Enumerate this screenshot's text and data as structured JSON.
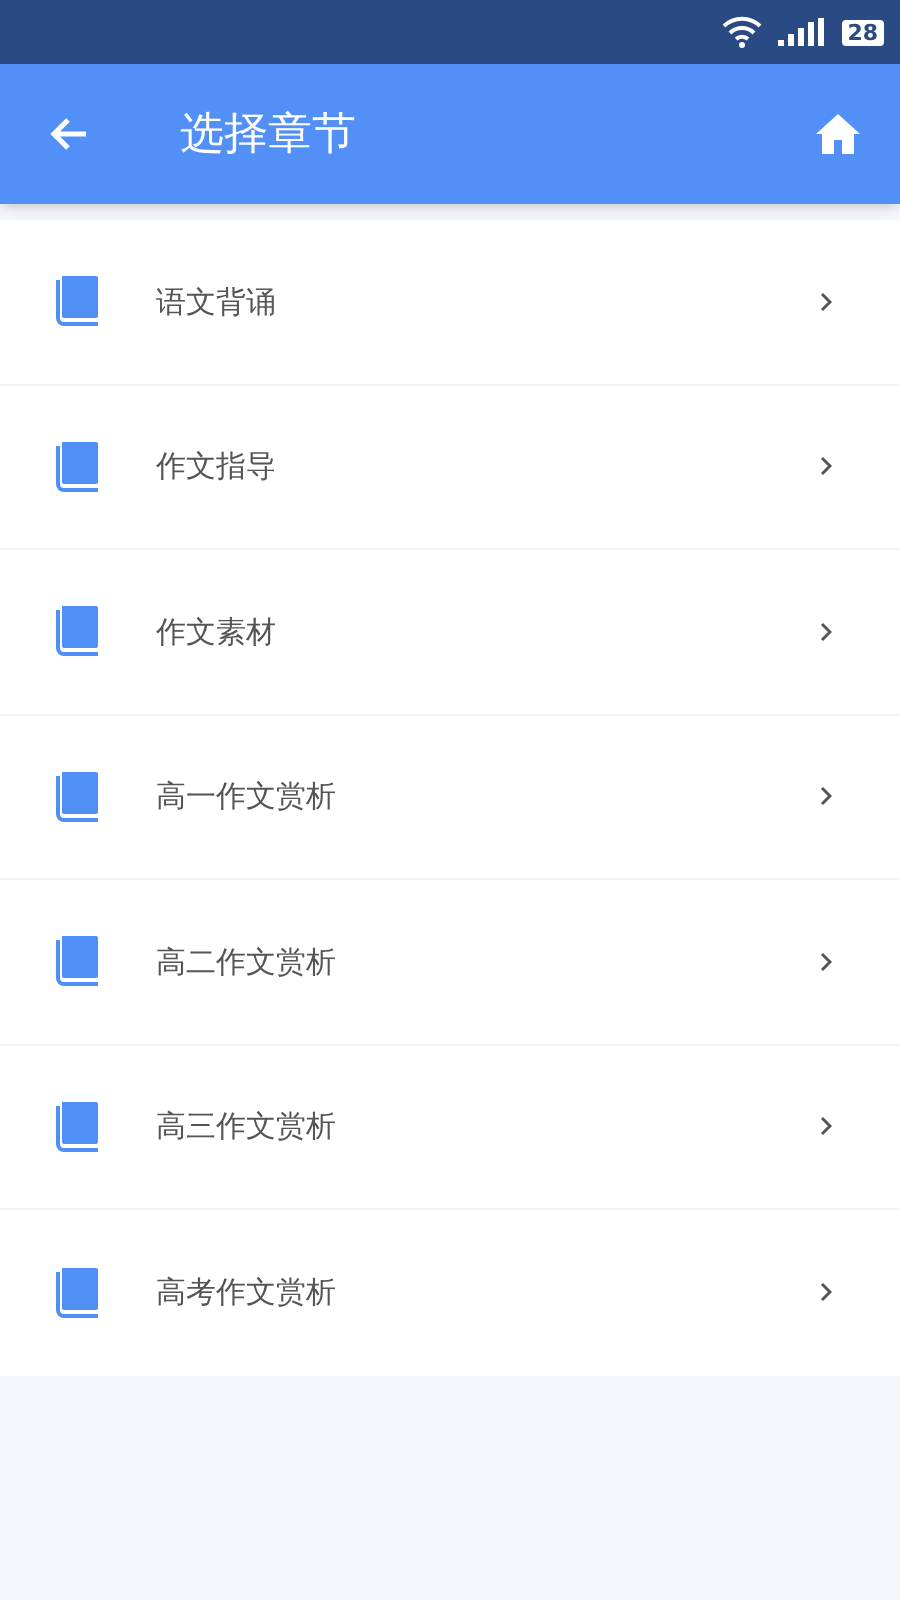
{
  "status_bar": {
    "battery": "28"
  },
  "header": {
    "title": "选择章节"
  },
  "chapters": [
    {
      "label": "语文背诵"
    },
    {
      "label": "作文指导"
    },
    {
      "label": "作文素材"
    },
    {
      "label": "高一作文赏析"
    },
    {
      "label": "高二作文赏析"
    },
    {
      "label": "高三作文赏析"
    },
    {
      "label": "高考作文赏析"
    }
  ]
}
